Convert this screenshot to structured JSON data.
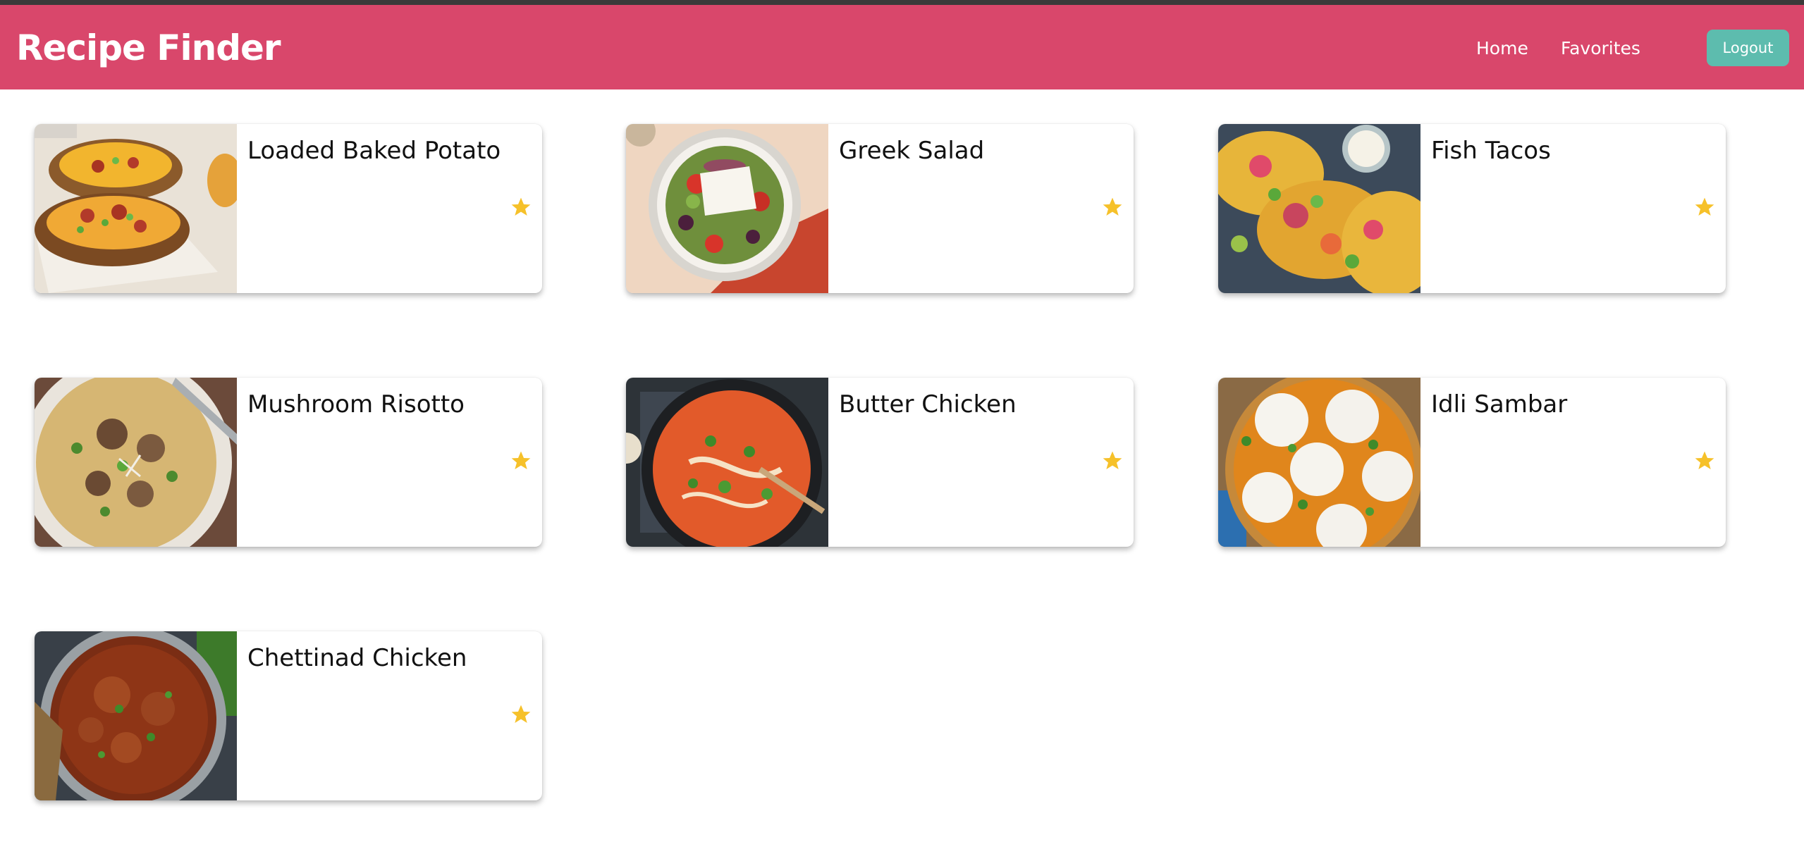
{
  "app": {
    "title": "Recipe Finder"
  },
  "nav": {
    "home": "Home",
    "favorites": "Favorites",
    "logout": "Logout"
  },
  "colors": {
    "header": "#d9476b",
    "logout": "#5dbcae",
    "star": "#f6c12a"
  },
  "recipes": [
    {
      "title": "Loaded Baked Potato",
      "image": "loaded-baked-potato-photo"
    },
    {
      "title": "Greek Salad",
      "image": "greek-salad-photo"
    },
    {
      "title": "Fish Tacos",
      "image": "fish-tacos-photo"
    },
    {
      "title": "Mushroom Risotto",
      "image": "mushroom-risotto-photo"
    },
    {
      "title": "Butter Chicken",
      "image": "butter-chicken-photo"
    },
    {
      "title": "Idli Sambar",
      "image": "idli-sambar-photo"
    },
    {
      "title": "Chettinad Chicken",
      "image": "chettinad-chicken-photo"
    }
  ]
}
